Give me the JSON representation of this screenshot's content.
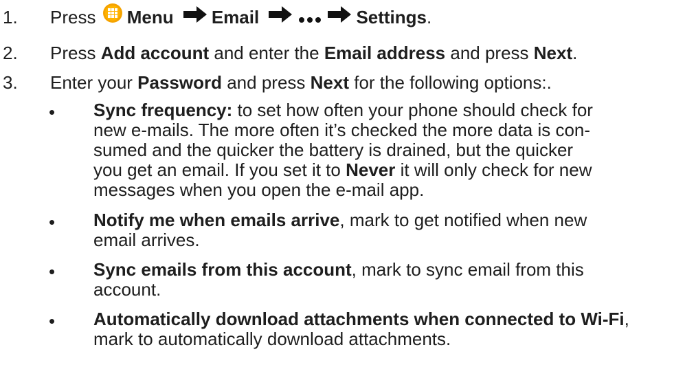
{
  "steps": [
    {
      "number": "1.",
      "press": "Press",
      "menu": "Menu",
      "email": "Email",
      "settings": "Settings",
      "period": ".",
      "menu_icon": "grid-menu-icon",
      "arrow_icon": "right-arrow-icon",
      "more_icon": "more-dots-icon",
      "icon_color": "#f5a300"
    },
    {
      "number": "2.",
      "t1": "Press ",
      "b1": "Add account",
      "t2": " and enter the ",
      "b2": "Email address",
      "t3": " and press ",
      "b3": "Next",
      "t4": "."
    },
    {
      "number": "3.",
      "t1": "Enter your ",
      "b1": "Password",
      "t2": " and press ",
      "b2": "Next",
      "t3": " for the following options:."
    }
  ],
  "bullets": [
    {
      "marker": "•",
      "lines": [
        {
          "b": "Sync frequency:",
          "t": " to set how often your phone should check for"
        },
        {
          "t": "new e-mails. The more often it’s checked the more data is con-"
        },
        {
          "t": "sumed and the quicker the battery is drained, but the quicker"
        },
        {
          "t": "you get an email. If you set it to ",
          "b": "Never",
          "t2": " it will only check for new"
        },
        {
          "t": "messages when you open the e-mail app."
        }
      ]
    },
    {
      "marker": "•",
      "lines": [
        {
          "b": "Notify me when emails arrive",
          "t": ", mark to get notified when new"
        },
        {
          "t": "email arrives."
        }
      ]
    },
    {
      "marker": "•",
      "lines": [
        {
          "b": "Sync emails from this account",
          "t": ", mark to sync email from this"
        },
        {
          "t": "account."
        }
      ]
    },
    {
      "marker": "•",
      "lines": [
        {
          "b": "Automatically download attachments when connected to Wi-Fi",
          "t": ","
        },
        {
          "t": "mark to automatically download attachments."
        }
      ]
    }
  ]
}
